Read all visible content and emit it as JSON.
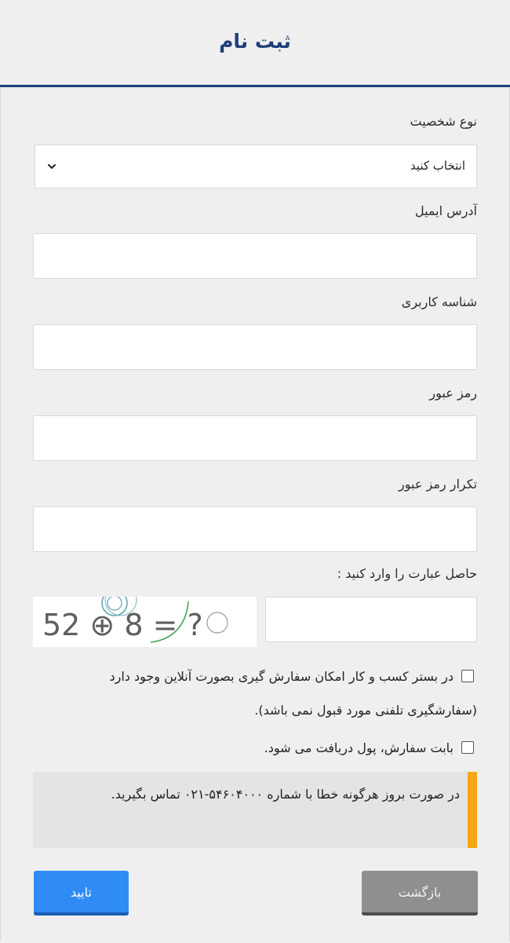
{
  "header": {
    "title": "ثبت نام"
  },
  "form": {
    "person_type": {
      "label": "نوع شخصیت",
      "selected": "انتخاب کنید"
    },
    "email": {
      "label": "آدرس ایمیل",
      "value": ""
    },
    "username": {
      "label": "شناسه کاربری",
      "value": ""
    },
    "password": {
      "label": "رمز عبور",
      "value": ""
    },
    "password_repeat": {
      "label": "تکرار رمز عبور",
      "value": ""
    },
    "captcha": {
      "label": "حاصل عبارت را وارد کنید :",
      "expression": "52 ⊕ 8 = ?",
      "value": ""
    },
    "checks": [
      {
        "label_line1": "در بستر کسب و کار امکان سفارش گیری بصورت آنلاین وجود دارد",
        "label_line2": "(سفارشگیری تلفنی مورد قبول نمی باشد)."
      },
      {
        "label_line1": "بابت سفارش، پول دریافت می شود."
      }
    ],
    "notice": "در صورت بروز هرگونه خطا با شماره ۵۴۶۰۴۰۰۰-۰۲۱ تماس بگیرید.",
    "submit_label": "تایید",
    "back_label": "بازگشت"
  },
  "colors": {
    "brand": "#1e3f7a",
    "submit": "#2f8cf5",
    "back": "#8f8f8f",
    "notice_accent": "#f7a712"
  },
  "icons": {
    "select_arrow": "chevron-down-icon"
  }
}
